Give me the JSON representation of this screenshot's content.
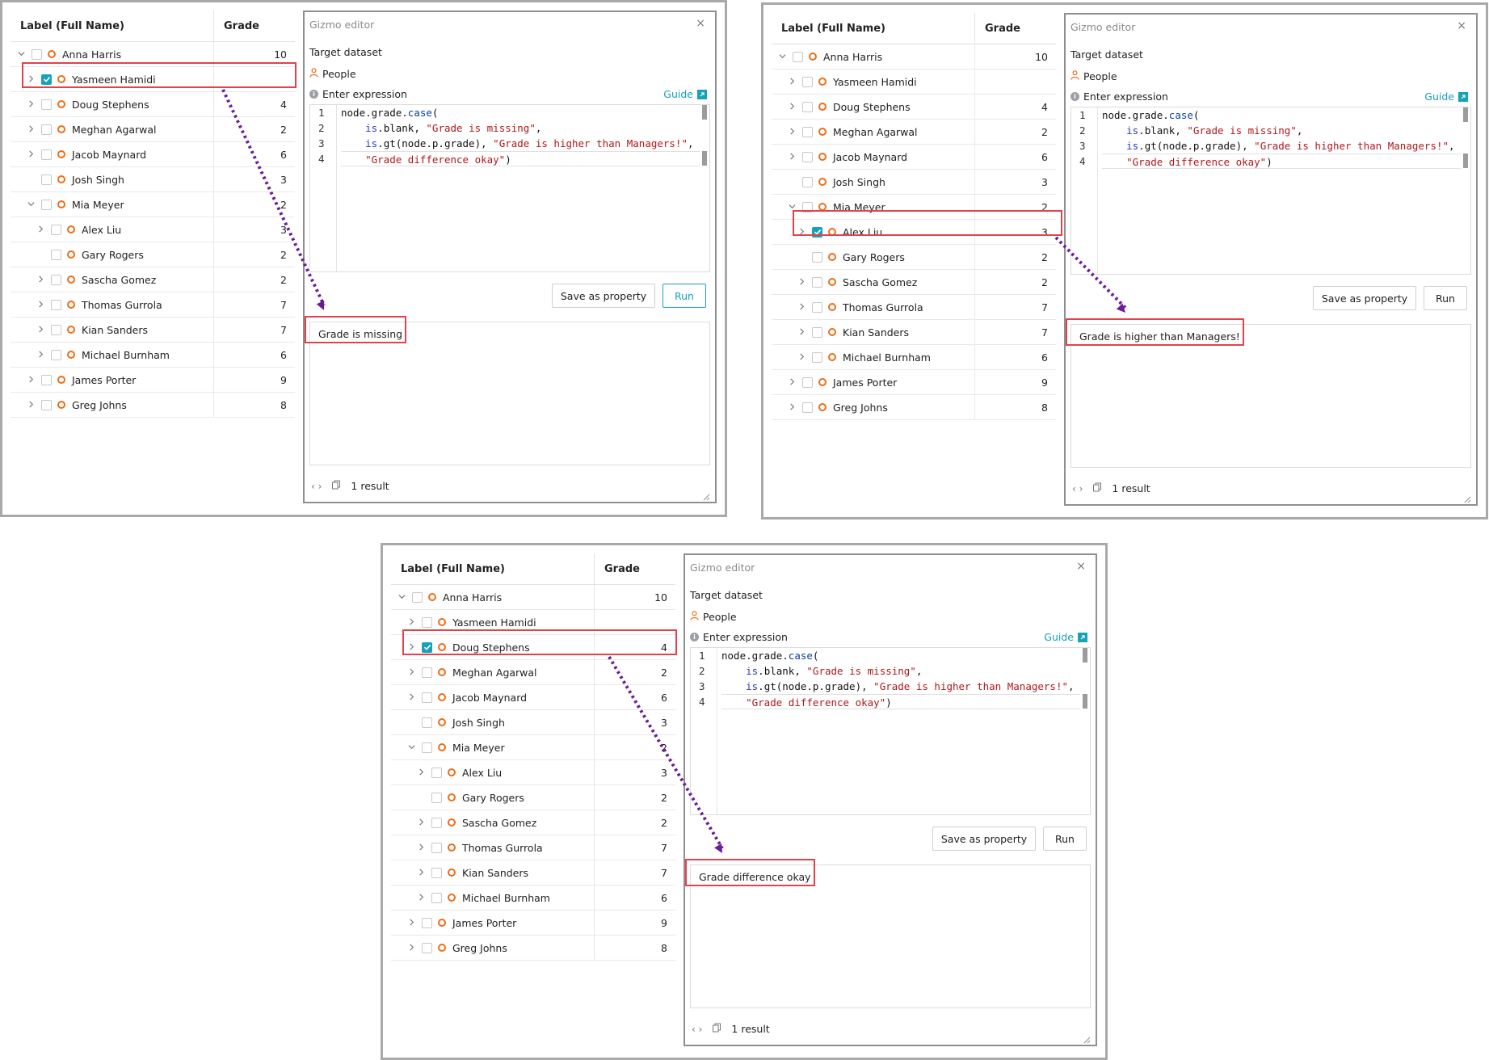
{
  "tree": {
    "header_label": "Label (Full Name)",
    "header_grade": "Grade",
    "rows": [
      {
        "label": "Anna Harris",
        "grade": "10",
        "level": 0,
        "chevron": "down"
      },
      {
        "label": "Yasmeen Hamidi",
        "grade": "",
        "level": 1,
        "chevron": "right"
      },
      {
        "label": "Doug Stephens",
        "grade": "4",
        "level": 1,
        "chevron": "right"
      },
      {
        "label": "Meghan Agarwal",
        "grade": "2",
        "level": 1,
        "chevron": "right"
      },
      {
        "label": "Jacob Maynard",
        "grade": "6",
        "level": 1,
        "chevron": "right"
      },
      {
        "label": "Josh Singh",
        "grade": "3",
        "level": 1,
        "chevron": "none"
      },
      {
        "label": "Mia Meyer",
        "grade": "2",
        "level": 1,
        "chevron": "down"
      },
      {
        "label": "Alex Liu",
        "grade": "3",
        "level": 2,
        "chevron": "right"
      },
      {
        "label": "Gary Rogers",
        "grade": "2",
        "level": 2,
        "chevron": "none"
      },
      {
        "label": "Sascha Gomez",
        "grade": "2",
        "level": 2,
        "chevron": "right"
      },
      {
        "label": "Thomas Gurrola",
        "grade": "7",
        "level": 2,
        "chevron": "right"
      },
      {
        "label": "Kian Sanders",
        "grade": "7",
        "level": 2,
        "chevron": "right"
      },
      {
        "label": "Michael Burnham",
        "grade": "6",
        "level": 2,
        "chevron": "right"
      },
      {
        "label": "James Porter",
        "grade": "9",
        "level": 1,
        "chevron": "right"
      },
      {
        "label": "Greg Johns",
        "grade": "8",
        "level": 1,
        "chevron": "right"
      }
    ]
  },
  "editor": {
    "title": "Gizmo editor",
    "close": "×",
    "target_label": "Target dataset",
    "dataset": "People",
    "expression_label": "Enter expression",
    "guide": "Guide",
    "line_numbers": [
      "1",
      "2",
      "3",
      "4"
    ],
    "save_button": "Save as property",
    "run_button": "Run",
    "result_count": "1 result"
  },
  "panels": [
    {
      "selected_row": 1,
      "result": "Grade is missing",
      "run_active": true
    },
    {
      "selected_row": 7,
      "result": "Grade is higher than Managers!",
      "run_active": false
    },
    {
      "selected_row": 2,
      "result": "Grade difference okay",
      "run_active": false
    }
  ],
  "colors": {
    "accent": "#17a2b8",
    "highlight": "#e0434b",
    "node": "#ee6d18",
    "arrow": "#6a1b9a"
  },
  "icons": {
    "close": "close-icon",
    "person": "person-icon",
    "info": "info-icon",
    "external": "external-link-icon",
    "code": "code-icon",
    "copy": "copy-icon"
  }
}
